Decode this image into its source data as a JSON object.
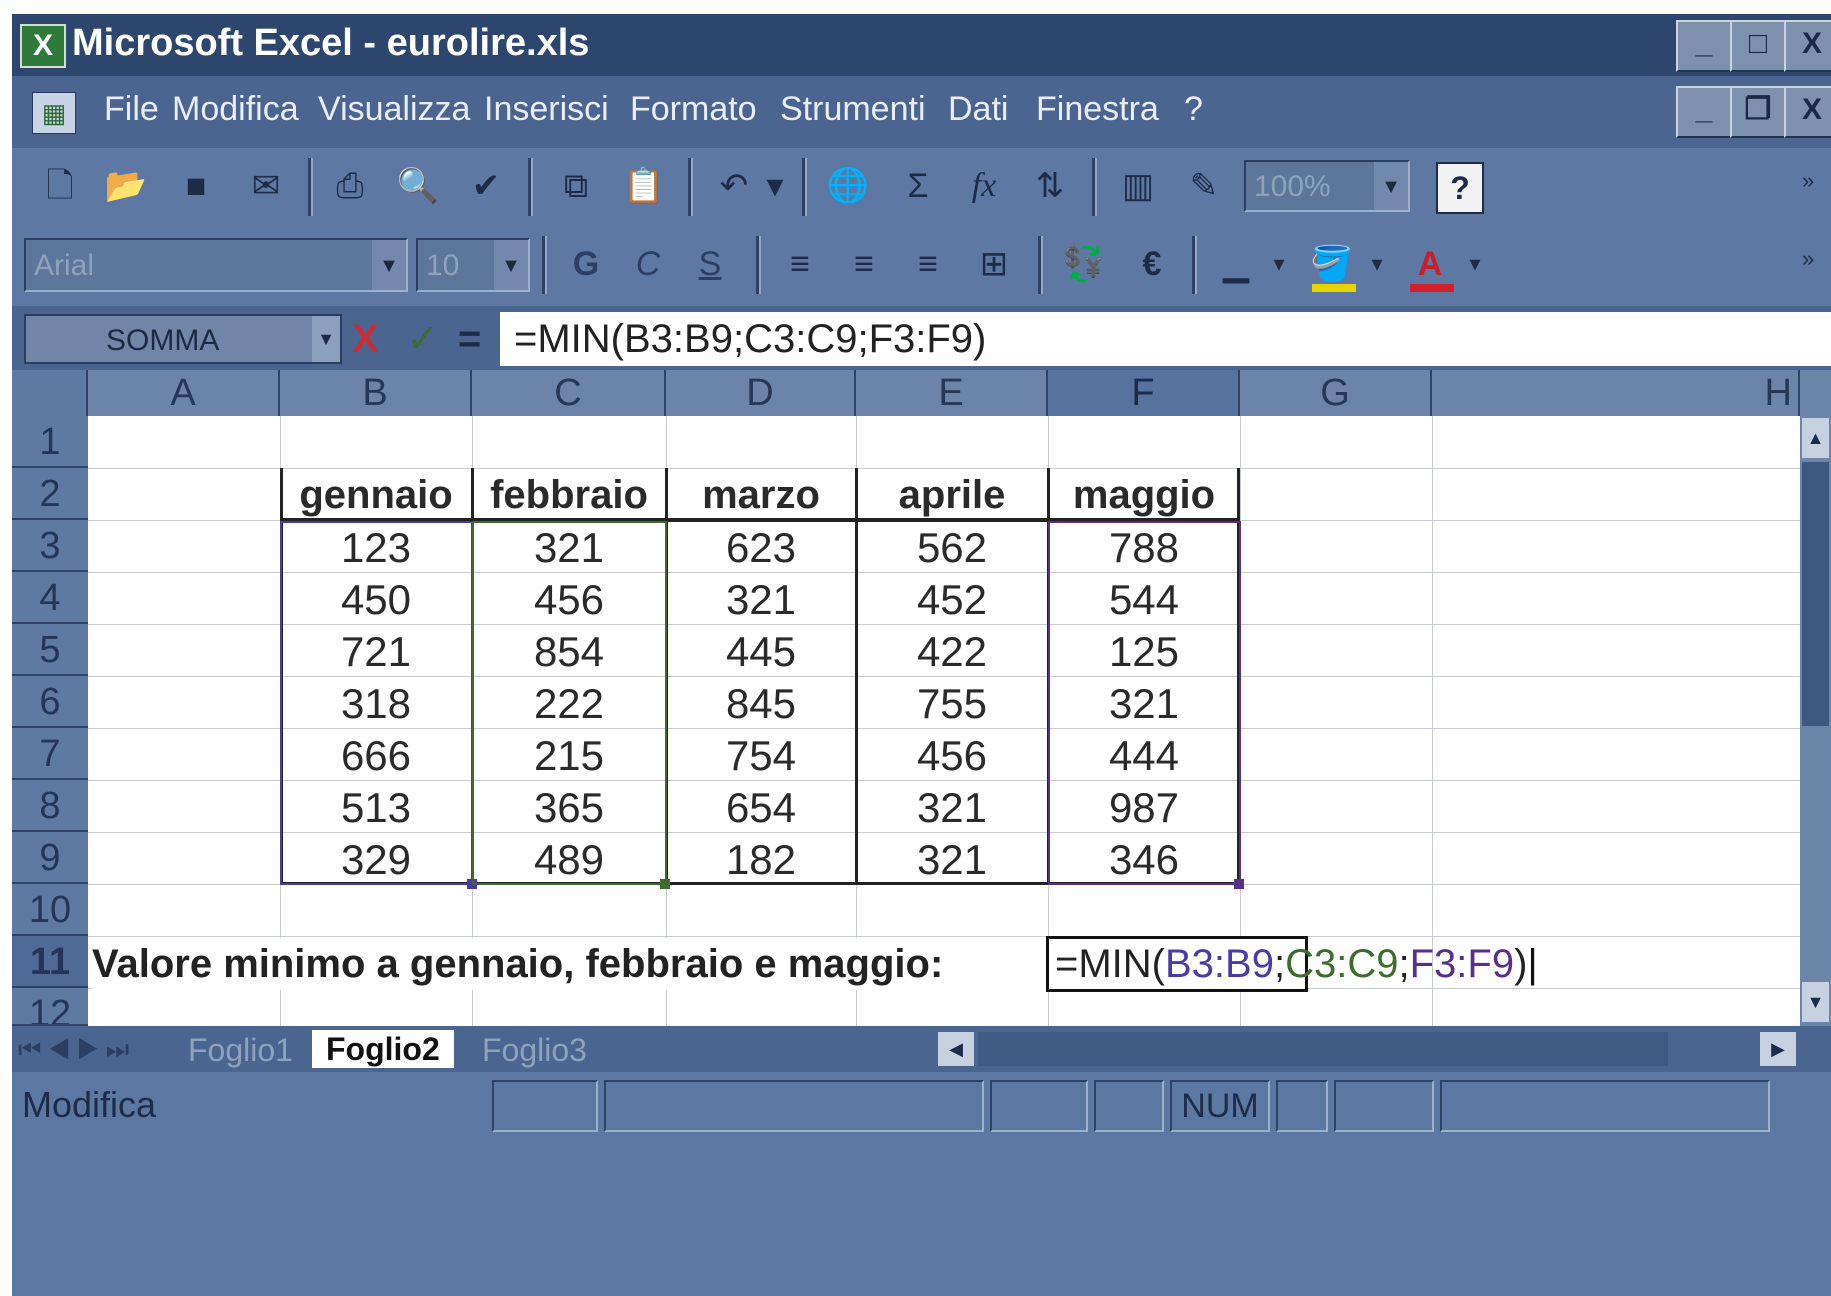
{
  "window": {
    "title": "Microsoft Excel - eurolire.xls",
    "min": "_",
    "max": "□",
    "close": "X"
  },
  "menu": [
    "File",
    "Modifica",
    "Visualizza",
    "Inserisci",
    "Formato",
    "Strumenti",
    "Dati",
    "Finestra",
    "?"
  ],
  "toolbar": {
    "zoom": "100%",
    "help": "?"
  },
  "format_toolbar": {
    "font": "Arial",
    "size": "10",
    "bold": "G",
    "italic": "C",
    "underline": "S",
    "euro": "€",
    "font_color": "A"
  },
  "formula_bar": {
    "name_box": "SOMMA",
    "cancel": "X",
    "enter": "✓",
    "equals": "=",
    "formula": "=MIN(B3:B9;C3:C9;F3:F9)"
  },
  "columns": [
    "A",
    "B",
    "C",
    "D",
    "E",
    "F",
    "G",
    "H"
  ],
  "rows": [
    "1",
    "2",
    "3",
    "4",
    "5",
    "6",
    "7",
    "8",
    "9",
    "10",
    "11",
    "12"
  ],
  "table": {
    "headers": [
      "gennaio",
      "febbraio",
      "marzo",
      "aprile",
      "maggio"
    ],
    "data": [
      [
        "123",
        "321",
        "623",
        "562",
        "788"
      ],
      [
        "450",
        "456",
        "321",
        "452",
        "544"
      ],
      [
        "721",
        "854",
        "445",
        "422",
        "125"
      ],
      [
        "318",
        "222",
        "845",
        "755",
        "321"
      ],
      [
        "666",
        "215",
        "754",
        "456",
        "444"
      ],
      [
        "513",
        "365",
        "654",
        "321",
        "987"
      ],
      [
        "329",
        "489",
        "182",
        "321",
        "346"
      ]
    ]
  },
  "row11": {
    "label": "Valore minimo a gennaio, febbraio e maggio:",
    "formula": {
      "start": "=MIN(",
      "r1": "B3:B9",
      "s1": ";",
      "r2": "C3:C9",
      "s2": ";",
      "r3": "F3:F9",
      "end": ")"
    }
  },
  "sheets": [
    "Foglio1",
    "Foglio2",
    "Foglio3"
  ],
  "active_sheet": "Foglio2",
  "status": {
    "mode": "Modifica",
    "num": "NUM"
  },
  "colors": {
    "range_b": "#4b3aa8",
    "range_c": "#3f6b2f",
    "range_f": "#5a2f8c",
    "frame": "#3f5a83"
  }
}
